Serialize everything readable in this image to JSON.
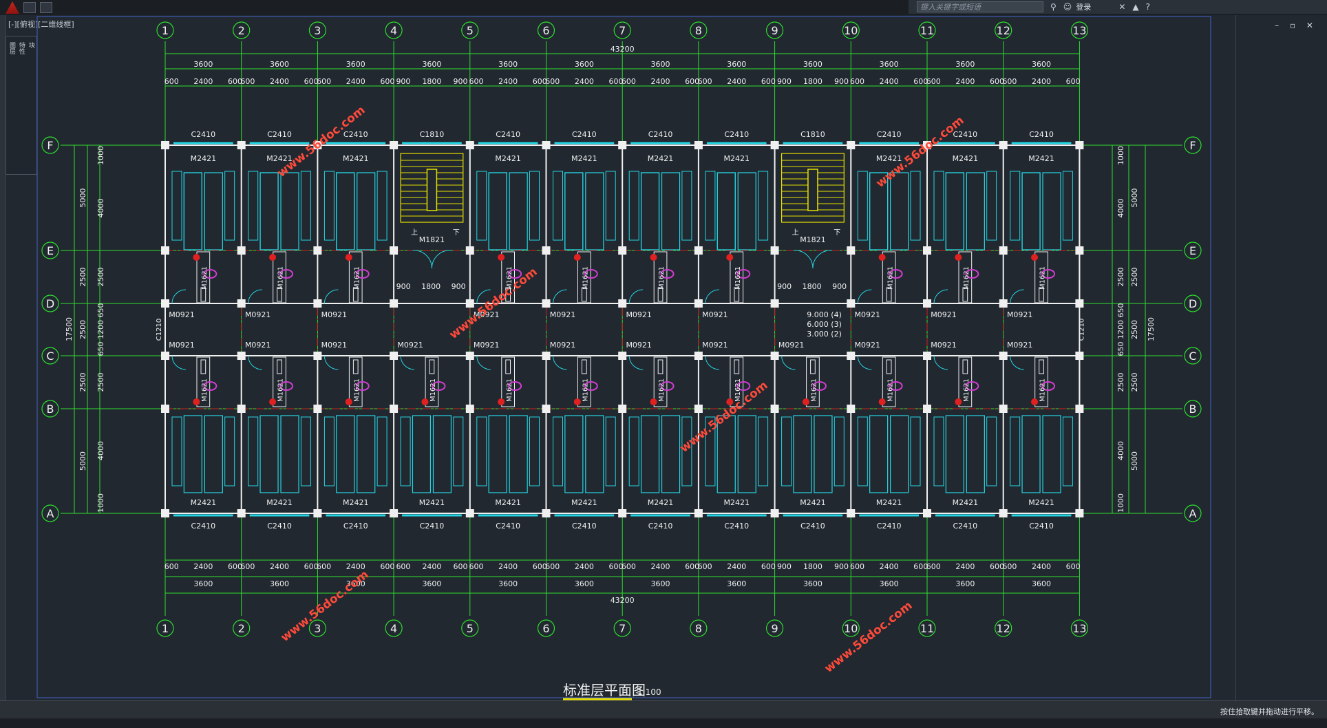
{
  "app": {
    "search_placeholder": "键入关键字或短语",
    "login_label": "登录",
    "view_label": "[-][俯视][二维线框]",
    "status_message": "按住拾取键并拖动进行平移。",
    "palette_labels": [
      "图层",
      "特性",
      "块"
    ]
  },
  "drawing": {
    "title": "标准层平面图",
    "scale": "1:100",
    "total_dim": "43200",
    "grid_cols": [
      "1",
      "2",
      "3",
      "4",
      "5",
      "6",
      "7",
      "8",
      "9",
      "10",
      "11",
      "12",
      "13"
    ],
    "grid_rows": [
      "F",
      "E",
      "D",
      "C",
      "B",
      "A"
    ],
    "bay_dim": "3600",
    "top_sub_dims": [
      "600",
      "2400",
      "600",
      "600",
      "2400",
      "600",
      "600",
      "2400",
      "600",
      "900",
      "1800",
      "900",
      "600",
      "2400",
      "600",
      "600",
      "2400",
      "600",
      "600",
      "2400",
      "600",
      "600",
      "2400",
      "600",
      "900",
      "1800",
      "900",
      "600",
      "2400",
      "600",
      "600",
      "2400",
      "600",
      "600",
      "2400",
      "600"
    ],
    "top_windows": [
      "C2410",
      "C2410",
      "C2410",
      "C1810",
      "C2410",
      "C2410",
      "C2410",
      "C2410",
      "C1810",
      "C2410",
      "C2410",
      "C2410"
    ],
    "bottom_windows": [
      "C2410",
      "C2410",
      "C2410",
      "C2410",
      "C2410",
      "C2410",
      "C2410",
      "C2410",
      "C2410",
      "C2410",
      "C2410",
      "C2410"
    ],
    "top_doors": [
      "M2421",
      "M2421",
      "M2421",
      "M2421",
      "M2421",
      "M2421",
      "M2421",
      "M2421",
      "M2421",
      "M2421"
    ],
    "bottom_doors": [
      "M2421",
      "M2421",
      "M2421",
      "M2421",
      "M2421",
      "M2421",
      "M2421",
      "M2421",
      "M2421",
      "M2421",
      "M2421",
      "M2421"
    ],
    "corridor_doors": "M0921",
    "bath_door": "M1621",
    "stair_door": "M1821",
    "stair_up": "上",
    "stair_down": "下",
    "stair_dims": [
      "900",
      "1800",
      "900"
    ],
    "side_window": "C1210",
    "left_dims_outer": [
      "5000",
      "2500",
      "17500",
      "2500",
      "5000"
    ],
    "left_dims_inner": [
      "1000",
      "4000",
      "2500",
      "650",
      "1200",
      "650",
      "2500",
      "4000",
      "1000"
    ],
    "left_dims_mid": "2500",
    "elevations": [
      "9.000 (4)",
      "6.000 (3)",
      "3.000 (2)"
    ],
    "watermark": "www.56doc.com"
  }
}
